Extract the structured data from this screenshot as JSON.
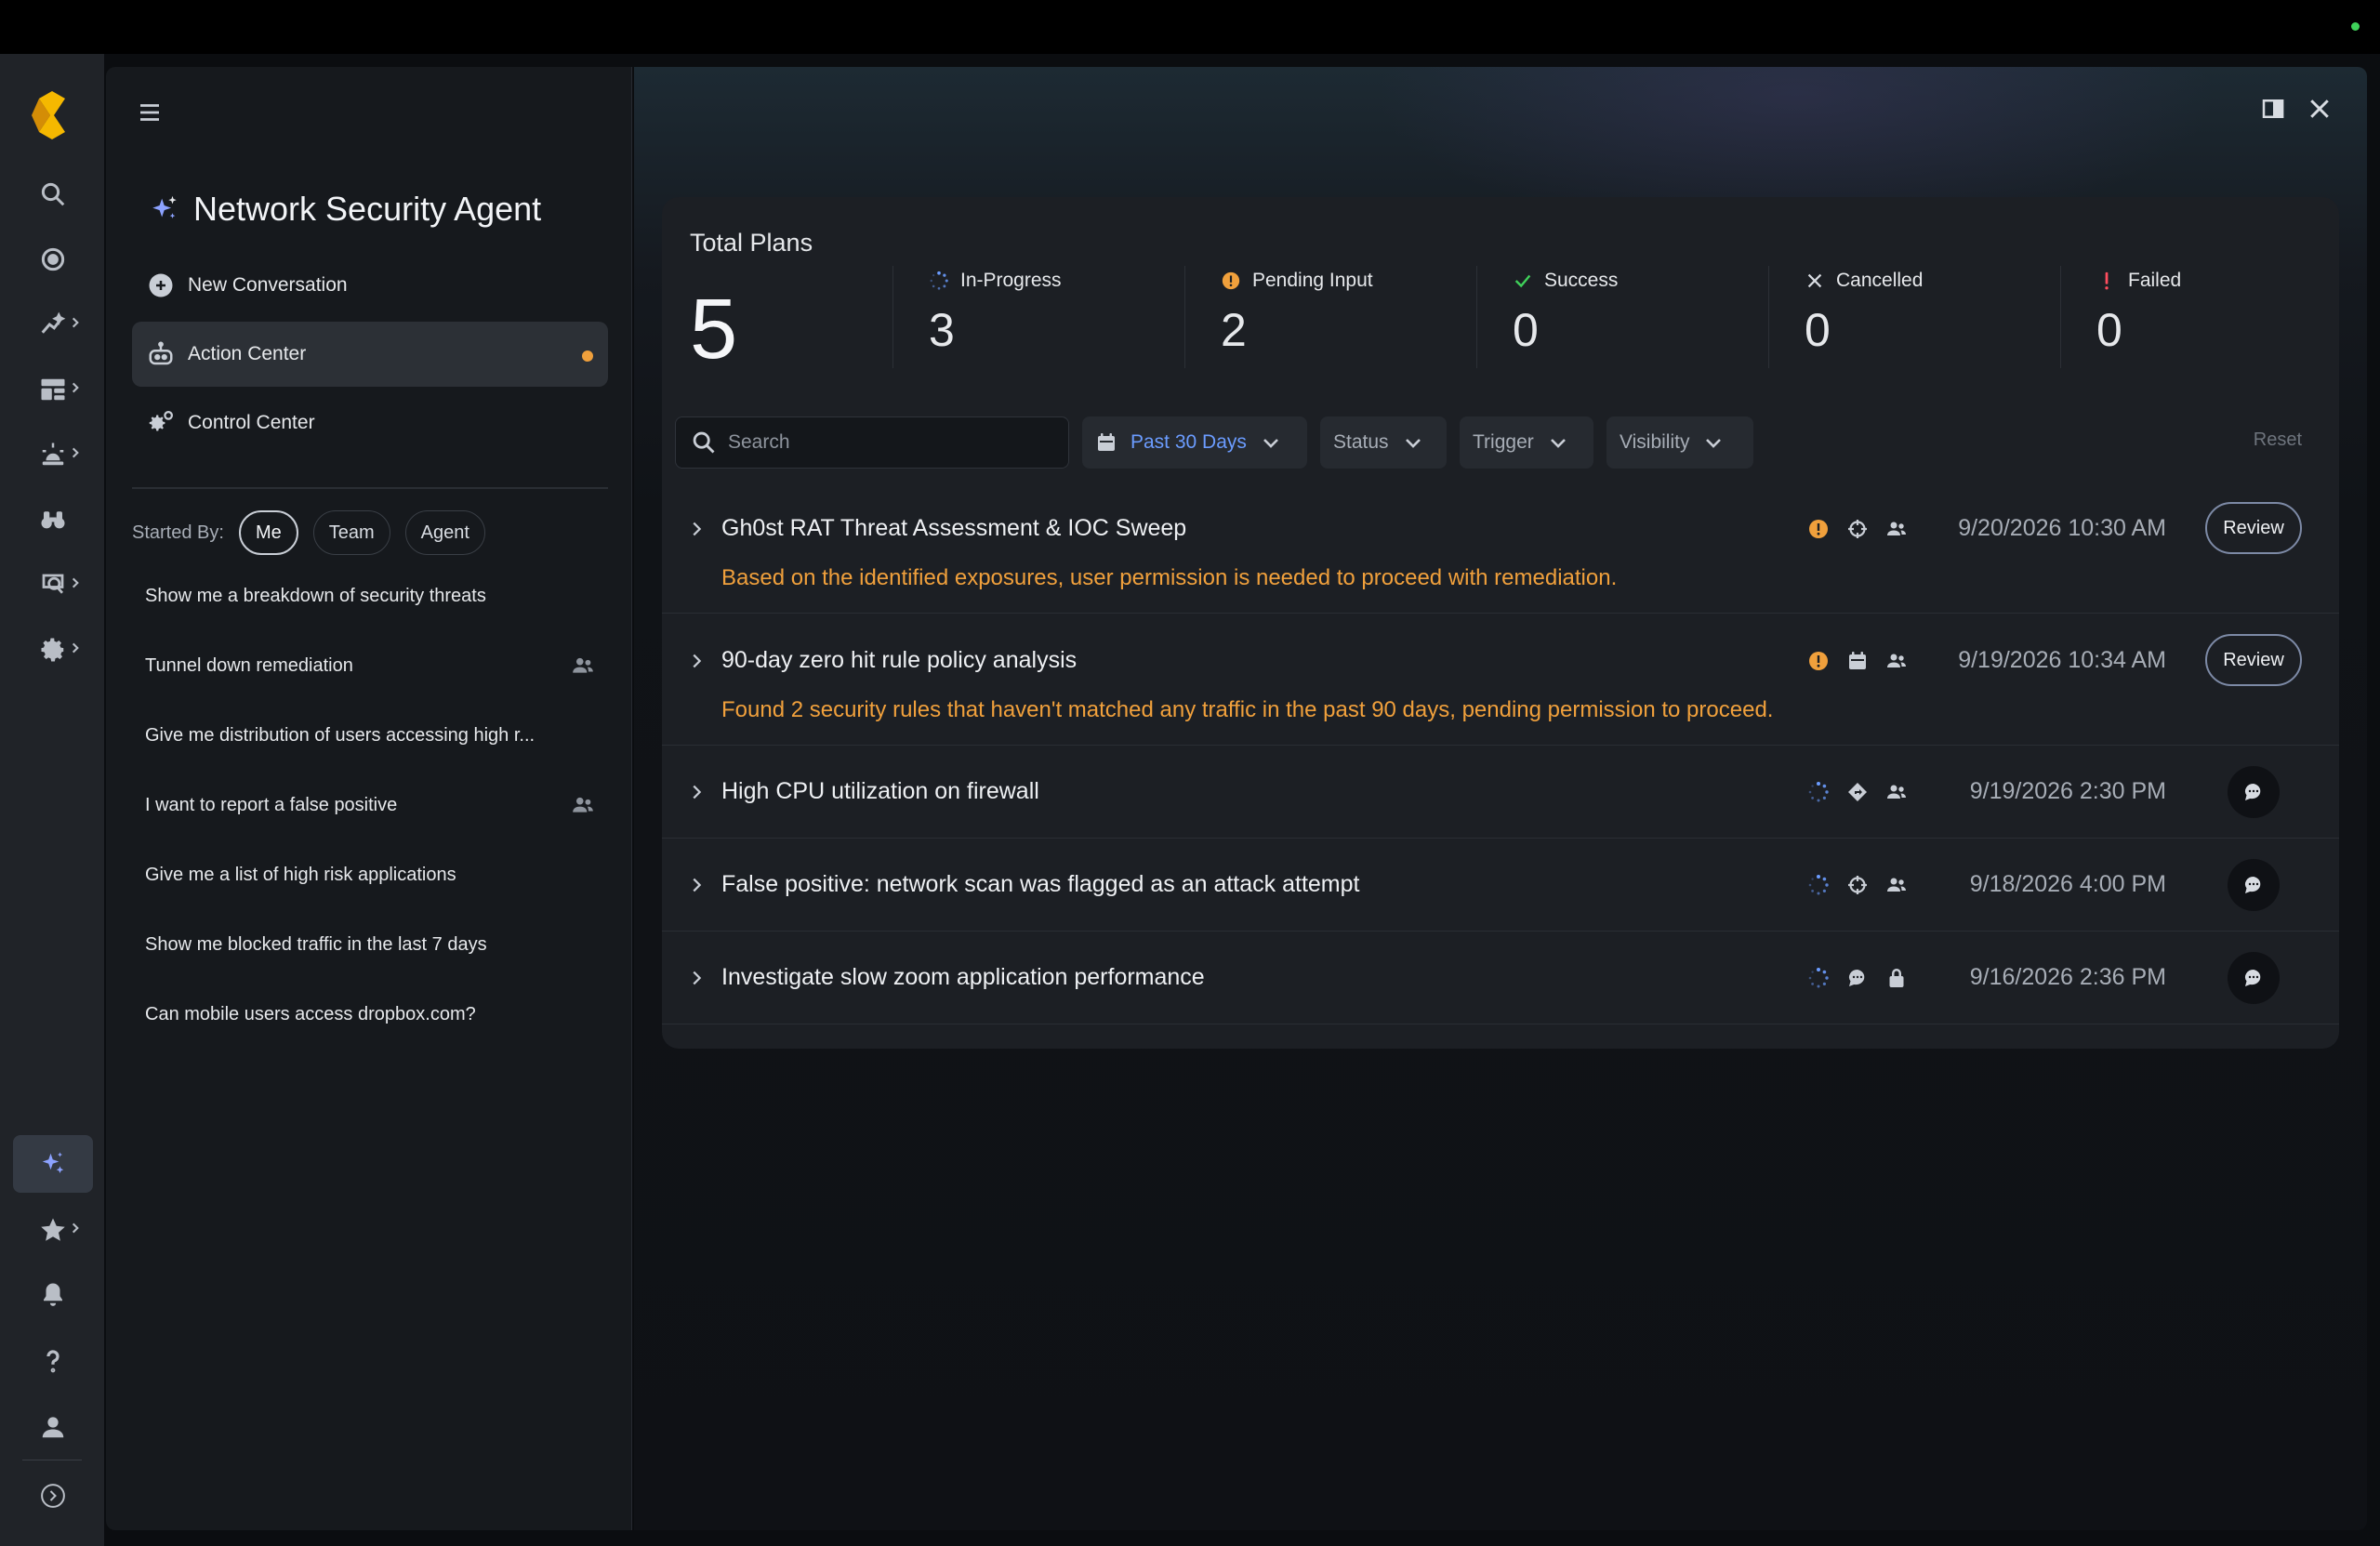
{
  "sidebar": {
    "agent_title": "Network Security Agent",
    "nav": [
      {
        "label": "New Conversation"
      },
      {
        "label": "Action Center"
      },
      {
        "label": "Control Center"
      }
    ],
    "started_by_label": "Started By:",
    "filters": [
      "Me",
      "Team",
      "Agent"
    ],
    "conversations": [
      {
        "label": "Show me a breakdown of security threats",
        "team": false
      },
      {
        "label": "Tunnel down remediation",
        "team": true
      },
      {
        "label": "Give me distribution of users accessing high r...",
        "team": false
      },
      {
        "label": "I want to report a false positive",
        "team": true
      },
      {
        "label": "Give me a list of high risk applications",
        "team": false
      },
      {
        "label": "Show me blocked traffic in the last 7 days",
        "team": false
      },
      {
        "label": "Can mobile users access dropbox.com?",
        "team": false
      }
    ]
  },
  "summary": {
    "title": "Total Plans",
    "total": "5",
    "stats": [
      {
        "label": "In-Progress",
        "value": "3",
        "icon": "spinner-icon"
      },
      {
        "label": "Pending Input",
        "value": "2",
        "icon": "pending-icon"
      },
      {
        "label": "Success",
        "value": "0",
        "icon": "check-icon"
      },
      {
        "label": "Cancelled",
        "value": "0",
        "icon": "x-icon"
      },
      {
        "label": "Failed",
        "value": "0",
        "icon": "exclamation-icon"
      }
    ]
  },
  "filters": {
    "search_placeholder": "Search",
    "date_range": "Past 30 Days",
    "status": "Status",
    "trigger": "Trigger",
    "visibility": "Visibility",
    "reset": "Reset"
  },
  "plans": [
    {
      "title": "Gh0st RAT Threat Assessment & IOC Sweep",
      "desc": "Based on the identified exposures, user permission is needed to proceed with remediation.",
      "date": "9/20/2026 10:30 AM",
      "action": "Review"
    },
    {
      "title": "90-day zero hit rule policy analysis",
      "desc": "Found 2 security rules that haven't matched any traffic in the past 90 days, pending permission to proceed.",
      "date": "9/19/2026 10:34 AM",
      "action": "Review"
    },
    {
      "title": "High CPU utilization on firewall",
      "desc": "",
      "date": "9/19/2026 2:30 PM",
      "action": ""
    },
    {
      "title": "False positive: network scan was flagged as an attack attempt",
      "desc": "",
      "date": "9/18/2026 4:00 PM",
      "action": ""
    },
    {
      "title": "Investigate slow zoom application performance",
      "desc": "",
      "date": "9/16/2026 2:36 PM",
      "action": ""
    }
  ],
  "colors": {
    "accent": "#6b9cff",
    "pending": "#f0a03c",
    "success": "#3fd15a",
    "failed": "#ff4d5e",
    "logo": "#f5b800"
  }
}
